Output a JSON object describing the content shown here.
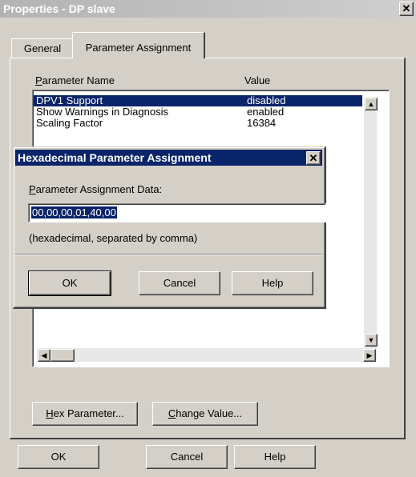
{
  "window": {
    "title": "Properties - DP slave",
    "close_icon": "close-icon"
  },
  "tabs": [
    {
      "label": "General",
      "active": false
    },
    {
      "label": "Parameter Assignment",
      "active": true
    }
  ],
  "list": {
    "col_name_underline": "P",
    "col_name_rest": "arameter Name",
    "col_value": "Value",
    "rows": [
      {
        "name": "DPV1 Support",
        "value": "disabled",
        "selected": true
      },
      {
        "name": "Show Warnings in Diagnosis",
        "value": "enabled",
        "selected": false
      },
      {
        "name": "Scaling Factor",
        "value": "16384",
        "selected": false
      }
    ]
  },
  "panel_buttons": {
    "hex_underline": "H",
    "hex_rest": "ex Parameter...",
    "change_underline": "C",
    "change_rest": "hange Value..."
  },
  "footer": {
    "ok": "OK",
    "cancel": "Cancel",
    "help": "Help"
  },
  "dialog": {
    "title": "Hexadecimal Parameter Assignment",
    "label_underline": "P",
    "label_rest": "arameter Assignment Data:",
    "input_value": "00,00,00,01,40,00",
    "hint": "(hexadecimal, separated by comma)",
    "ok": "OK",
    "cancel": "Cancel",
    "help": "Help"
  },
  "colors": {
    "selection": "#0a246a",
    "face": "#d4d0c8"
  }
}
